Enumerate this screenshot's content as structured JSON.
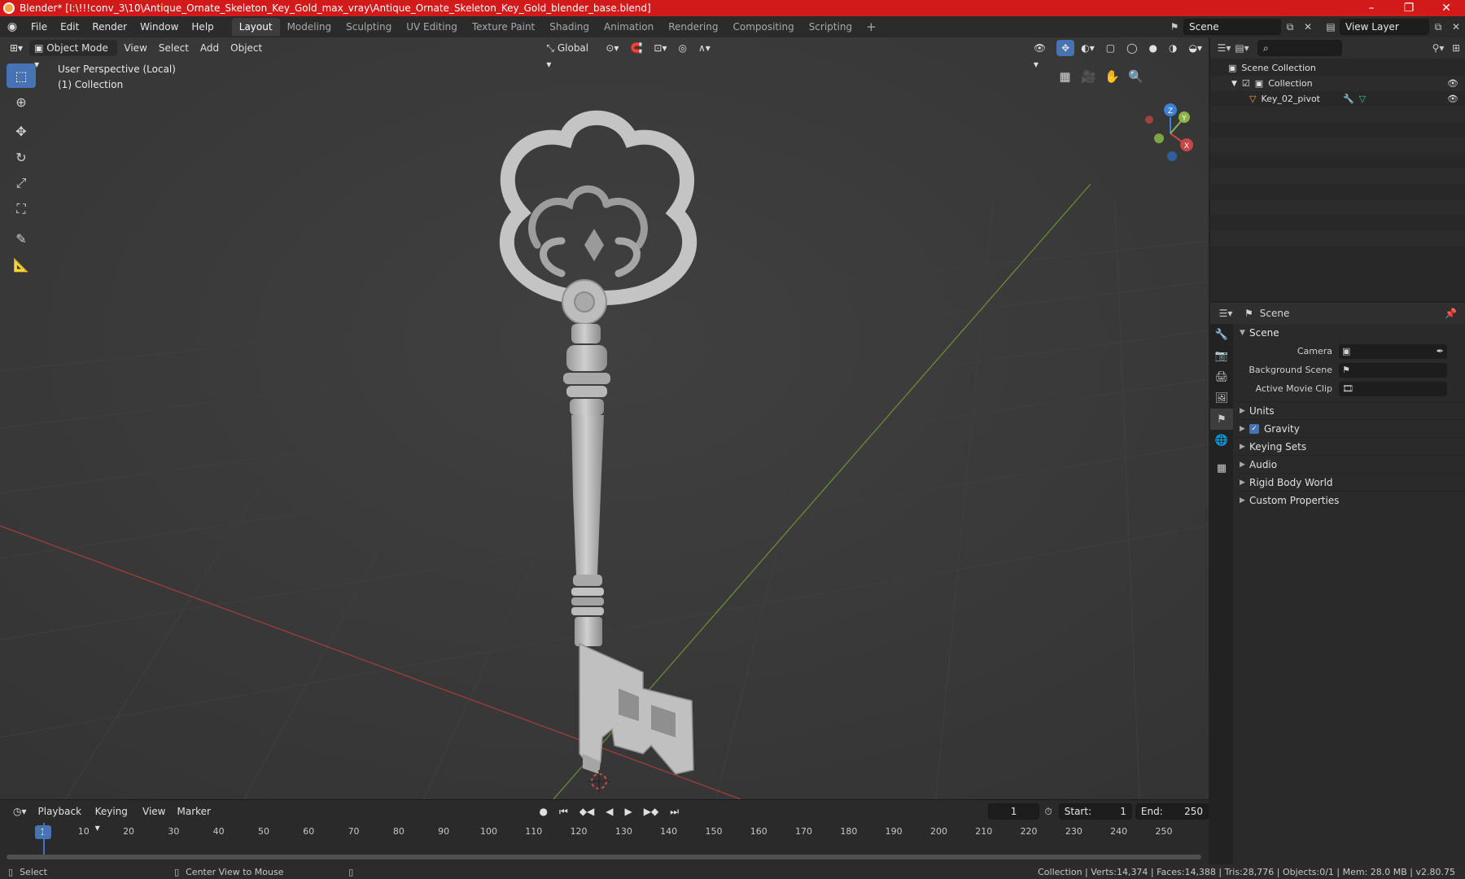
{
  "window": {
    "title": "Blender* [I:\\!!!conv_3\\10\\Antique_Ornate_Skeleton_Key_Gold_max_vray\\Antique_Ornate_Skeleton_Key_Gold_blender_base.blend]",
    "minimize": "–",
    "maximize": "❐",
    "close": "✕"
  },
  "menubar": {
    "items": [
      "File",
      "Edit",
      "Render",
      "Window",
      "Help"
    ],
    "workspaces": [
      "Layout",
      "Modeling",
      "Sculpting",
      "UV Editing",
      "Texture Paint",
      "Shading",
      "Animation",
      "Rendering",
      "Compositing",
      "Scripting"
    ],
    "active_workspace": "Layout",
    "add_workspace": "+",
    "scene_name": "Scene",
    "view_layer": "View Layer"
  },
  "viewport": {
    "mode": "Object Mode",
    "menus": [
      "View",
      "Select",
      "Add",
      "Object"
    ],
    "orientation": "Global",
    "info_line1": "User Perspective (Local)",
    "info_line2": "(1) Collection",
    "gizmo_axes": {
      "x": "X",
      "y": "Y",
      "z": "Z"
    }
  },
  "outliner": {
    "search_placeholder": "",
    "root": "Scene Collection",
    "collection": "Collection",
    "object": "Key_02_pivot"
  },
  "properties": {
    "header_title": "Scene",
    "panel": "Scene",
    "camera_label": "Camera",
    "background_scene_label": "Background Scene",
    "active_movie_clip_label": "Active Movie Clip",
    "subpanels": [
      "Units",
      "Gravity",
      "Keying Sets",
      "Audio",
      "Rigid Body World",
      "Custom Properties"
    ],
    "gravity_checked": true
  },
  "timeline": {
    "menus": [
      "Playback",
      "Keying",
      "View",
      "Marker"
    ],
    "current_frame": "1",
    "start_label": "Start:",
    "start_value": "1",
    "end_label": "End:",
    "end_value": "250",
    "ticks": [
      "10",
      "20",
      "30",
      "40",
      "50",
      "60",
      "70",
      "80",
      "90",
      "100",
      "110",
      "120",
      "130",
      "140",
      "150",
      "160",
      "170",
      "180",
      "190",
      "200",
      "210",
      "220",
      "230",
      "240",
      "250"
    ],
    "marker_label": "1"
  },
  "statusbar": {
    "left_action": "Select",
    "middle_action": "Center View to Mouse",
    "stats": "Collection | Verts:14,374 | Faces:14,388 | Tris:28,776 | Objects:0/1 | Mem: 28.0 MB | v2.80.75"
  },
  "colors": {
    "titlebar": "#d21a1a",
    "accent": "#4772b3",
    "x_axis": "#c74646",
    "y_axis": "#8bb34a",
    "z_axis": "#3d82d6"
  }
}
